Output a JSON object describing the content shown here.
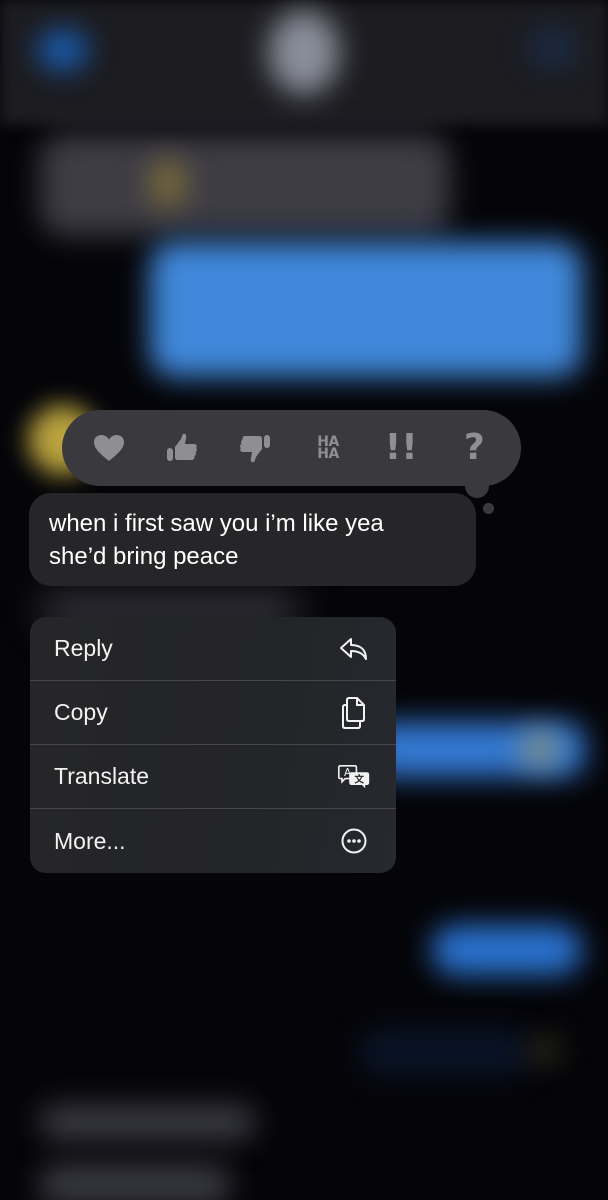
{
  "background": {
    "description": "blurred conversation",
    "colors": {
      "blue_bubble": "#4088da",
      "gray_bubble": "#3e3d45",
      "page": "#050509"
    }
  },
  "tapback": {
    "reactions": [
      {
        "name": "heart",
        "icon": "heart-icon"
      },
      {
        "name": "thumbs-up",
        "icon": "thumbs-up-icon"
      },
      {
        "name": "thumbs-down",
        "icon": "thumbs-down-icon"
      },
      {
        "name": "haha",
        "icon": "haha-icon",
        "line1": "HA",
        "line2": "HA"
      },
      {
        "name": "emphasize",
        "icon": "double-exclamation-icon",
        "glyph": "!!"
      },
      {
        "name": "question",
        "icon": "question-icon",
        "glyph": "?"
      }
    ],
    "icon_color": "#8e8e93"
  },
  "message": {
    "line1": "when i first saw you i’m like yea",
    "line2": "she’d bring peace"
  },
  "menu": {
    "items": [
      {
        "label": "Reply",
        "icon": "reply-icon"
      },
      {
        "label": "Copy",
        "icon": "copy-icon"
      },
      {
        "label": "Translate",
        "icon": "translate-icon"
      },
      {
        "label": "More...",
        "icon": "more-icon"
      }
    ]
  }
}
